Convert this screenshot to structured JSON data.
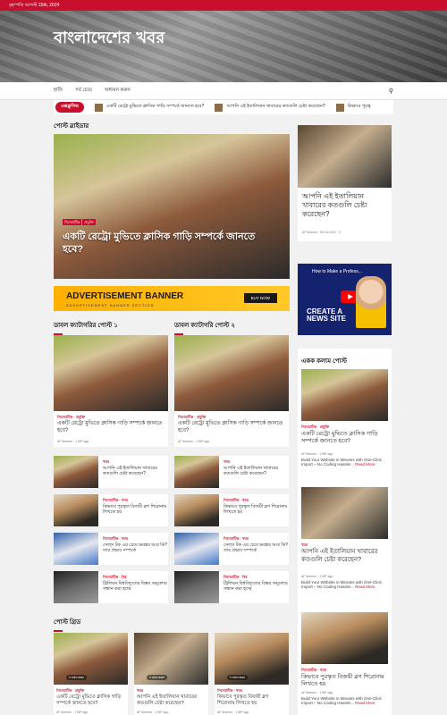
{
  "topbar": {
    "date": "বৃহস্পতি আগস্ট 15th, 2024"
  },
  "site": {
    "title": "বাংলাদেশের খবর"
  },
  "nav": {
    "items": [
      "হাফি",
      "সর্ব চেয়ে",
      "অধ্যয়ন করুন"
    ],
    "search_icon": "search-icon"
  },
  "ticker": {
    "label": "এক্সক্লুসিভ",
    "items": [
      "একটি রেট্রো মুভিতে ক্লাসিক গাড়ি সম্পর্কে জানতে হবে?",
      "আপনি এই ইতালিয়ান খাবারের কতগুলি চেষ্টা করেছেন?",
      "কিভাবে পুরস্কৃ"
    ]
  },
  "post_slider": {
    "section_title": "পোস্ট স্লাইডার",
    "cats": [
      "সিনেমাটিক",
      "প্রযুক্তি"
    ],
    "title": "একটি রেট্রো মুভিতে ক্লাসিক গাড়ি সম্পর্কে জানতে হবে?"
  },
  "ad": {
    "title": "ADVERTISEMENT BANNER",
    "subtitle": "ADVERTISEMENT BANNER SECTION",
    "button": "BUY NOW"
  },
  "right_top": {
    "title": "আপনি এই ইতালিয়ান খাবারের কতগুলি চেষ্টা করেছেন?",
    "author": "AF themes",
    "date": "09.16.2024",
    "comments": "0"
  },
  "video": {
    "title": "How to Make a Profess...",
    "big": "CREATE A NEWS SITE",
    "tag": "STEP-BY-STEP"
  },
  "double_cat": {
    "left_title": "ডাবল ক্যাটাগরির পোস্ট ১",
    "right_title": "ডাবল ক্যাটাগরি পোস্ট ২",
    "main": {
      "cat1": "সিনেমাটিক",
      "cat2": "প্রযুক্তি",
      "title": "একটি রেট্রো মুভিতে ক্লাসিক গাড়ি সম্পর্কে জানতে হবে?",
      "author": "AF themes",
      "ago": "1 WP ago"
    },
    "list": [
      {
        "cat": "খবর",
        "title": "আপনি এই ইতালিয়ান খাবারের কতগুলি চেষ্টা করেছেন?"
      },
      {
        "cat": "সিনেমাটিক · খবর",
        "title": "কিভাবে পুরস্কৃত বিজয়ী ব্লগ শিরোনাম লিখতে হয়"
      },
      {
        "cat": "সিনেমাটিক · খবর",
        "title": "সেল্স টক এর চেয়ে ভয়ঙ্কর আর কি? তার প্রভাব সম্পর্কে"
      },
      {
        "cat": "সিনেমাটিক · বিশ্ব",
        "title": "ট্রিলিয়ন বিশ্ববিদ্যুতের বিস্তর অমূল্যের সন্ধান করা হচ্ছে"
      }
    ]
  },
  "single_column": {
    "section_title": "একক কলাম পোস্ট",
    "items": [
      {
        "cat": "সিনেমাটিক · প্রযুক্তি",
        "title": "একটি রেট্রো মুভিতে ক্লাসিক গাড়ি সম্পর্কে জানতে হবে?",
        "author": "AF themes",
        "ago": "1 WP ago",
        "excerpt": "Build Your Website in Minutes with One-Click Import – No Coding Hassle!...",
        "more": "Read More"
      },
      {
        "cat": "খবর",
        "title": "আপনি এই ইতালিয়ান খাবারের কতগুলি চেষ্টা করেছেন?",
        "author": "AF themes",
        "ago": "1 WP ago",
        "excerpt": "Build Your Website in Minutes with One-Click Import – No Coding Hassle!...",
        "more": "Read More"
      },
      {
        "cat": "সিনেমাটিক · খবর",
        "title": "কিভাবে পুরস্কৃত বিজয়ী ব্লগ শিরোনাম লিখতে হয়",
        "author": "AF themes",
        "ago": "1 WP ago",
        "excerpt": "Build Your Website in Minutes with One-Click Import – No Coding Hassle!...",
        "more": "Read More"
      }
    ]
  },
  "post_grid": {
    "section_title": "পোস্ট গ্রিড",
    "items": [
      {
        "cat": "সিনেমাটিক · প্রযুক্তি",
        "title": "একটি রেট্রো মুভিতে ক্লাসিক গাড়ি সম্পর্কে জানতে হবে?",
        "author": "AF themes",
        "ago": "1 WP ago",
        "badge": "1 min read"
      },
      {
        "cat": "খবর",
        "title": "আপনি এই ইতালিয়ান খাবারের কতগুলি চেষ্টা করেছেন?",
        "author": "AF themes",
        "ago": "1 WP ago",
        "badge": "1 min read"
      },
      {
        "cat": "সিনেমাটিক · খবর",
        "title": "কিভাবে পুরস্কৃত বিজয়ী ব্লগ শিরোনাম লিখতে হয়",
        "author": "AF themes",
        "ago": "1 WP ago",
        "badge": "1 min read"
      }
    ]
  },
  "colors": {
    "accent": "#c8102e",
    "ad_yellow": "#ffc928"
  }
}
